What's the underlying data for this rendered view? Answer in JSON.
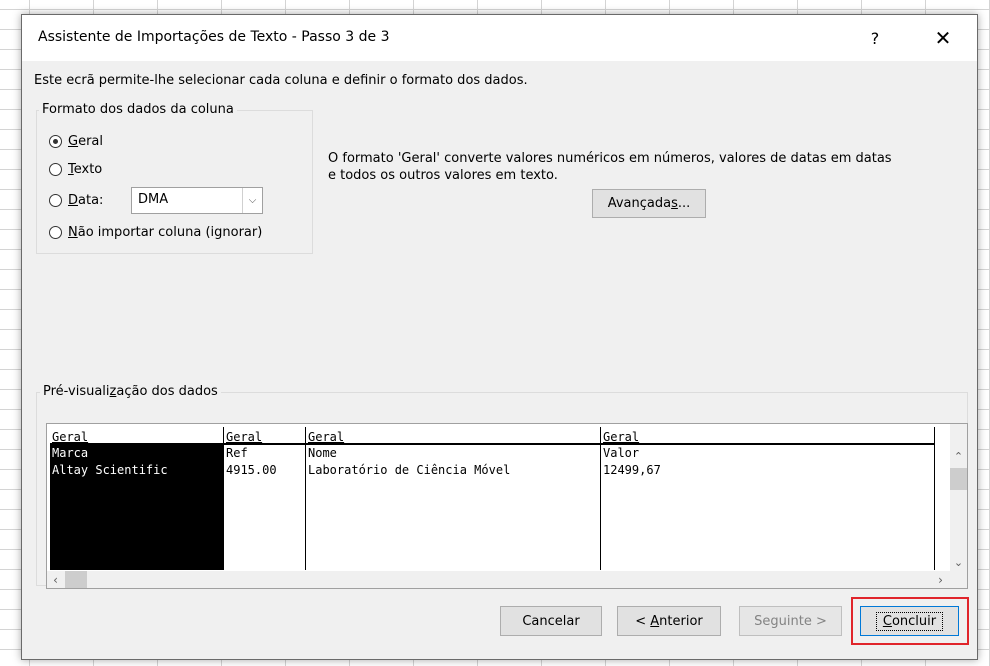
{
  "dialog": {
    "title": "Assistente de Importações de Texto - Passo 3 de 3",
    "help_glyph": "?",
    "close_glyph": "✕"
  },
  "intro_text": "Este ecrã permite-lhe selecionar cada coluna e definir o formato dos dados.",
  "format_group": {
    "label": "Formato dos dados da coluna",
    "options": [
      {
        "mnemonic": "G",
        "rest": "eral",
        "checked": true
      },
      {
        "mnemonic": "T",
        "rest": "exto",
        "checked": false
      },
      {
        "mnemonic": "D",
        "rest": "ata:",
        "checked": false
      },
      {
        "mnemonic": "N",
        "rest": "ão importar coluna (ignorar)",
        "checked": false
      }
    ],
    "date_select_value": "DMA"
  },
  "description": {
    "line1": "O formato 'Geral' converte valores numéricos em números, valores de datas em datas",
    "line2": "e todos os outros valores em texto."
  },
  "advanced_button": {
    "before": "Avançada",
    "mnemonic": "s",
    "after": "..."
  },
  "preview": {
    "label_before": "Pré-visuali",
    "label_mnemonic": "z",
    "label_after": "ação dos dados",
    "columns": [
      {
        "header": "Geral",
        "cells": [
          "Marca",
          "Altay Scientific"
        ]
      },
      {
        "header": "Geral",
        "cells": [
          "Ref",
          "4915.00"
        ]
      },
      {
        "header": "Geral",
        "cells": [
          "Nome",
          "Laboratório de Ciência Móvel"
        ]
      },
      {
        "header": "Geral",
        "cells": [
          "Valor",
          "12499,67"
        ]
      }
    ]
  },
  "buttons": {
    "cancel": "Cancelar",
    "back_prefix": "< ",
    "back_mnemonic": "A",
    "back_rest": "nterior",
    "next": "Seguinte >",
    "finish_mnemonic": "C",
    "finish_rest": "oncluir"
  },
  "colors": {
    "dialog_bg": "#f0f0f0",
    "highlight": "#e0252b",
    "default_button_border": "#0078d7"
  }
}
